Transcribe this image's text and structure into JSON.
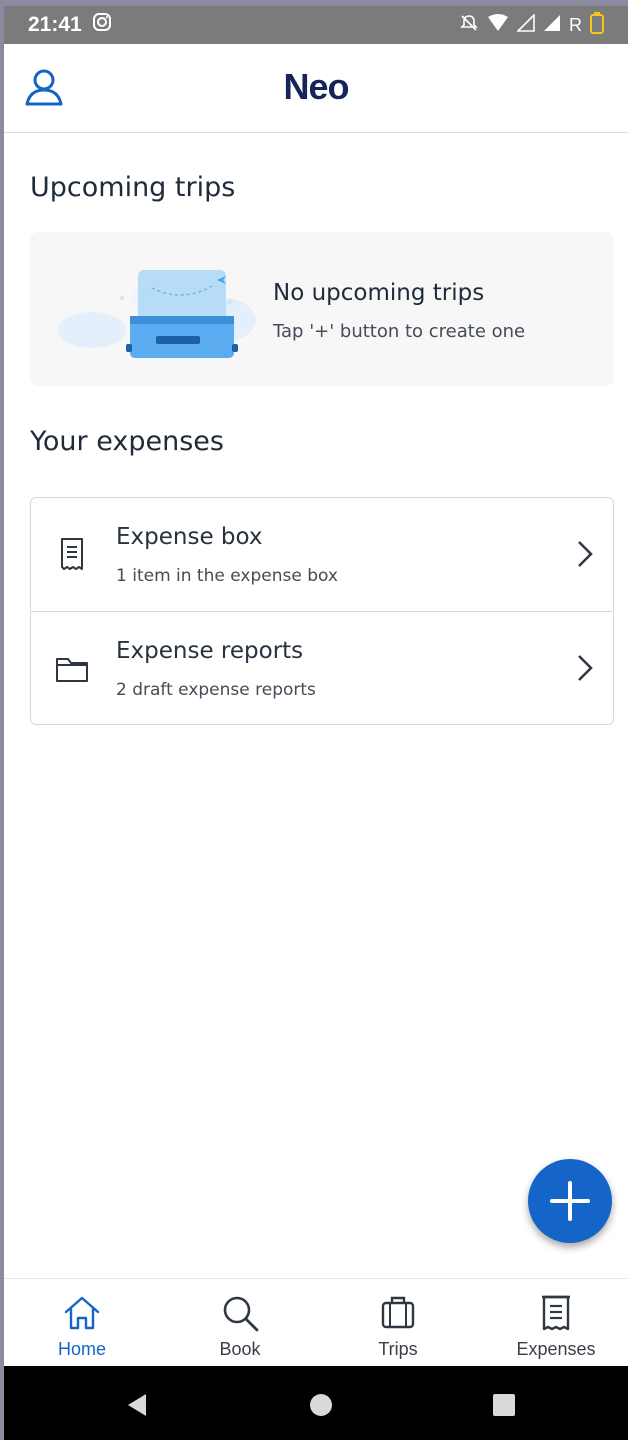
{
  "status_bar": {
    "time": "21:41",
    "signal_label": "R"
  },
  "header": {
    "title": "Neo"
  },
  "upcoming": {
    "section_title": "Upcoming trips",
    "empty_title": "No upcoming trips",
    "empty_hint": "Tap '+' button to create one"
  },
  "expenses": {
    "section_title": "Your expenses",
    "items": [
      {
        "label": "Expense box",
        "sublabel": "1 item in the expense box",
        "icon": "receipt-icon"
      },
      {
        "label": "Expense reports",
        "sublabel": "2 draft expense reports",
        "icon": "folder-icon"
      }
    ]
  },
  "fab": {
    "icon": "plus-icon"
  },
  "bottom_nav": {
    "items": [
      {
        "label": "Home",
        "icon": "home-icon",
        "active": true
      },
      {
        "label": "Book",
        "icon": "search-icon",
        "active": false
      },
      {
        "label": "Trips",
        "icon": "suitcase-icon",
        "active": false
      },
      {
        "label": "Expenses",
        "icon": "receipt-icon",
        "active": false
      }
    ]
  },
  "colors": {
    "brand": "#15245a",
    "accent": "#1565c9",
    "status_bar": "#7b7b7b"
  }
}
